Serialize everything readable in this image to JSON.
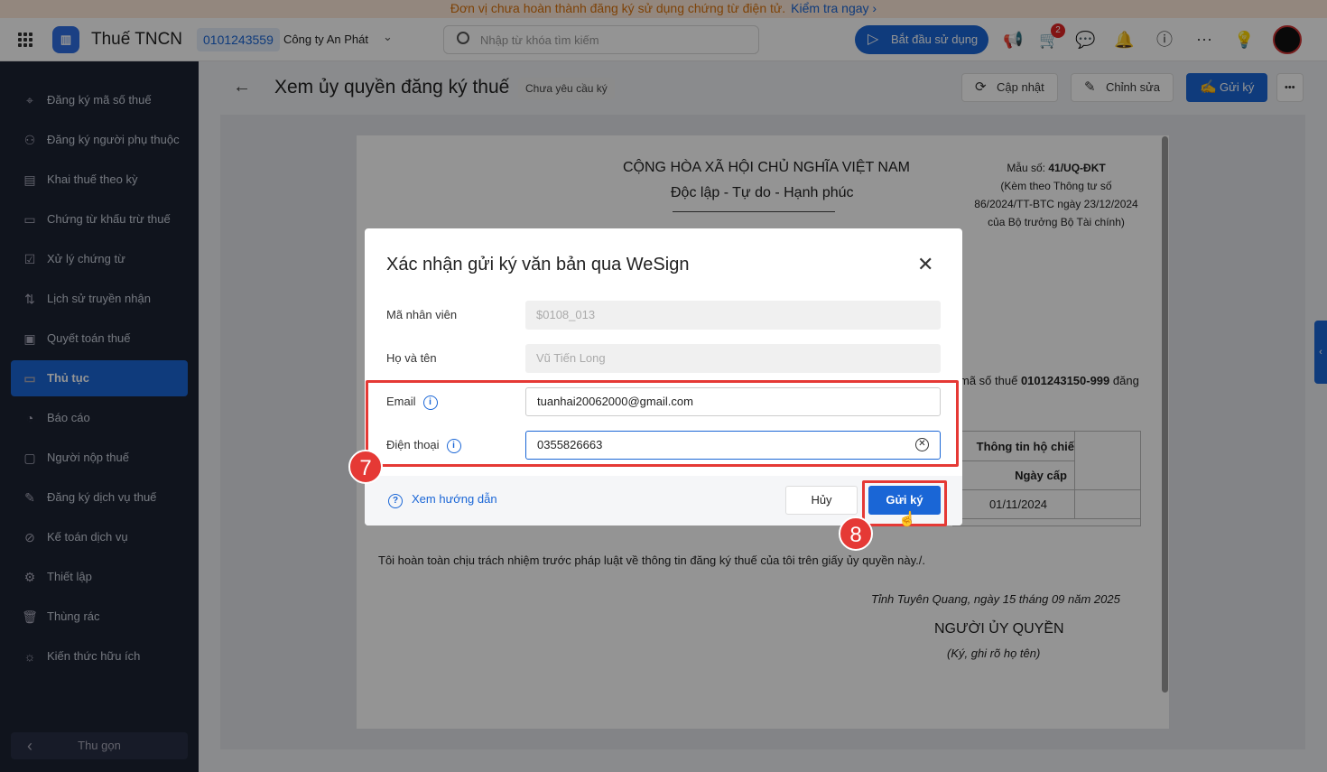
{
  "banner": {
    "text": "Đơn vị chưa hoàn thành đăng ký sử dụng chứng từ điện tử.",
    "link": "Kiểm tra ngay",
    "chevron": "›"
  },
  "header": {
    "app_name": "Thuế TNCN",
    "tax_code": "0101243559",
    "company": "Công ty An Phát",
    "search_placeholder": "Nhập từ khóa tìm kiếm",
    "start_button": "Bắt đầu sử dụng",
    "cart_badge": "2",
    "icons": [
      "apps-icon",
      "megaphone-icon",
      "cart-icon",
      "chat-icon",
      "bell-icon",
      "help-icon",
      "more-icon",
      "lightbulb-icon",
      "avatar"
    ]
  },
  "sidebar": {
    "items": [
      {
        "label": "Đăng ký mã số thuế",
        "icon": "⌖"
      },
      {
        "label": "Đăng ký người phụ thuộc",
        "icon": "⚇"
      },
      {
        "label": "Khai thuế theo kỳ",
        "icon": "▤"
      },
      {
        "label": "Chứng từ khấu trừ thuế",
        "icon": "▭"
      },
      {
        "label": "Xử lý chứng từ",
        "icon": "☑"
      },
      {
        "label": "Lịch sử truyền nhận",
        "icon": "⇅"
      },
      {
        "label": "Quyết toán thuế",
        "icon": "▣"
      },
      {
        "label": "Thủ tục",
        "icon": "▭"
      },
      {
        "label": "Báo cáo",
        "icon": "◔"
      },
      {
        "label": "Người nộp thuế",
        "icon": "▢"
      },
      {
        "label": "Đăng ký dịch vụ thuế",
        "icon": "✎"
      },
      {
        "label": "Kế toán dịch vụ",
        "icon": "⊘"
      },
      {
        "label": "Thiết lập",
        "icon": "⚙"
      },
      {
        "label": "Thùng rác",
        "icon": "🗑"
      },
      {
        "label": "Kiến thức hữu ích",
        "icon": "☼"
      }
    ],
    "active_index": 7,
    "collapse": "Thu gọn"
  },
  "page": {
    "title": "Xem ủy quyền đăng ký thuế",
    "status": "Chưa yêu cầu ký",
    "update": "Cập nhật",
    "edit": "Chỉnh sửa",
    "send": "Gửi ký",
    "more": "•••"
  },
  "document": {
    "nation": "CỘNG HÒA XÃ HỘI CHỦ NGHĨA VIỆT NAM",
    "motto": "Độc lập - Tự do - Hạnh phúc",
    "form_label": "Mẫu số:",
    "form_no": "41/UQ-ĐKT",
    "attached1": "(Kèm theo Thông tư số",
    "attached2": "86/2024/TT-BTC ngày 23/12/2024",
    "attached3": "của Bộ trưởng Bộ Tài chính)",
    "tax_prefix": "mã số thuế",
    "tax_no": "0101243150-999",
    "tax_suffix": "đăng",
    "table_header": "Thông tin hộ chiế",
    "table_sub": "Ngày cấp",
    "table_value": "01/11/2024",
    "commit": "Tôi hoàn toàn chịu trách nhiệm trước pháp luật về thông tin đăng ký thuế của tôi trên giấy ủy quyền này./.",
    "place_date": "Tỉnh Tuyên Quang, ngày 15 tháng 09 năm 2025",
    "signer": "NGƯỜI ỦY QUYỀN",
    "sign_note": "(Ký, ghi rõ họ tên)"
  },
  "modal": {
    "title": "Xác nhận gửi ký văn bản qua WeSign",
    "fields": [
      {
        "label": "Mã nhân viên",
        "value": "$0108_013"
      },
      {
        "label": "Họ và tên",
        "value": "Vũ Tiến Long"
      },
      {
        "label": "Email",
        "value": "tuanhai20062000@gmail.com"
      },
      {
        "label": "Điện thoại",
        "value": "0355826663"
      }
    ],
    "guide": "Xem hướng dẫn",
    "cancel": "Hủy",
    "send": "Gửi ký"
  },
  "annotations": {
    "step7": "7",
    "step8": "8",
    "color": "#e53935"
  }
}
